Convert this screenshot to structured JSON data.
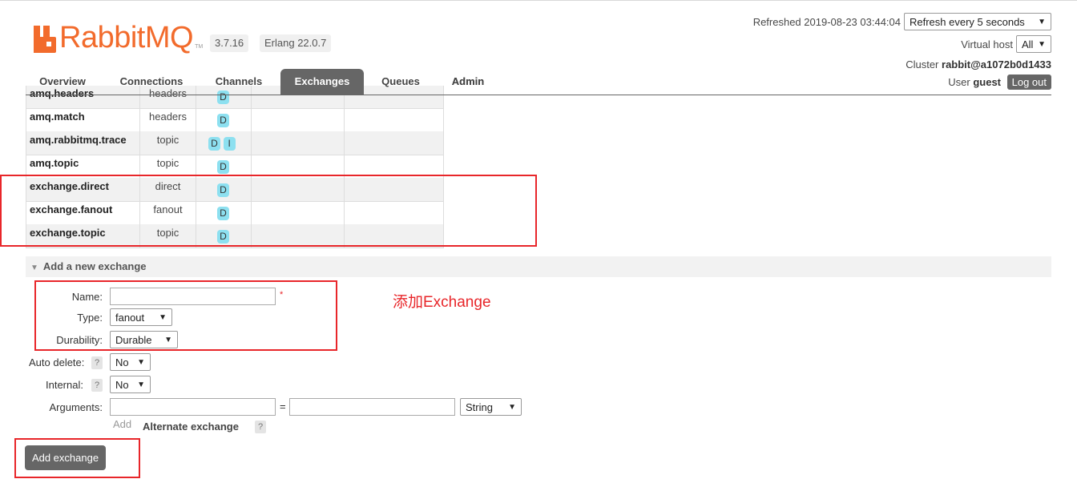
{
  "app": {
    "logo_text": "RabbitMQ",
    "logo_tm": "TM",
    "version": "3.7.16",
    "erlang": "Erlang 22.0.7"
  },
  "header": {
    "refreshed": "Refreshed 2019-08-23 03:44:04",
    "refresh_select": "Refresh every 5 seconds",
    "vhost_label": "Virtual host",
    "vhost_value": "All",
    "cluster_label": "Cluster",
    "cluster_value": "rabbit@a1072b0d1433",
    "user_label": "User",
    "user_value": "guest",
    "logout": "Log out"
  },
  "tabs": [
    {
      "label": "Overview",
      "active": false
    },
    {
      "label": "Connections",
      "active": false
    },
    {
      "label": "Channels",
      "active": false
    },
    {
      "label": "Exchanges",
      "active": true
    },
    {
      "label": "Queues",
      "active": false
    },
    {
      "label": "Admin",
      "active": false
    }
  ],
  "exchanges": [
    {
      "name": "amq.headers",
      "type": "headers",
      "features": [
        "D"
      ]
    },
    {
      "name": "amq.match",
      "type": "headers",
      "features": [
        "D"
      ]
    },
    {
      "name": "amq.rabbitmq.trace",
      "type": "topic",
      "features": [
        "D",
        "I"
      ]
    },
    {
      "name": "amq.topic",
      "type": "topic",
      "features": [
        "D"
      ]
    },
    {
      "name": "exchange.direct",
      "type": "direct",
      "features": [
        "D"
      ]
    },
    {
      "name": "exchange.fanout",
      "type": "fanout",
      "features": [
        "D"
      ]
    },
    {
      "name": "exchange.topic",
      "type": "topic",
      "features": [
        "D"
      ]
    }
  ],
  "annotation": "添加Exchange",
  "form": {
    "section_title": "Add a new exchange",
    "name_label": "Name:",
    "name_value": "",
    "required_mark": "*",
    "type_label": "Type:",
    "type_value": "fanout",
    "durability_label": "Durability:",
    "durability_value": "Durable",
    "auto_delete_label": "Auto delete:",
    "auto_delete_value": "No",
    "internal_label": "Internal:",
    "internal_value": "No",
    "arguments_label": "Arguments:",
    "arguments_eq": "=",
    "arguments_type": "String",
    "help": "?",
    "add_link": "Add",
    "alternate_exchange": "Alternate exchange",
    "submit": "Add exchange"
  },
  "colors": {
    "brand": "#f26b2c",
    "tab_active": "#666666",
    "feature_badge": "#8de0f0",
    "highlight": "#e8262a"
  }
}
